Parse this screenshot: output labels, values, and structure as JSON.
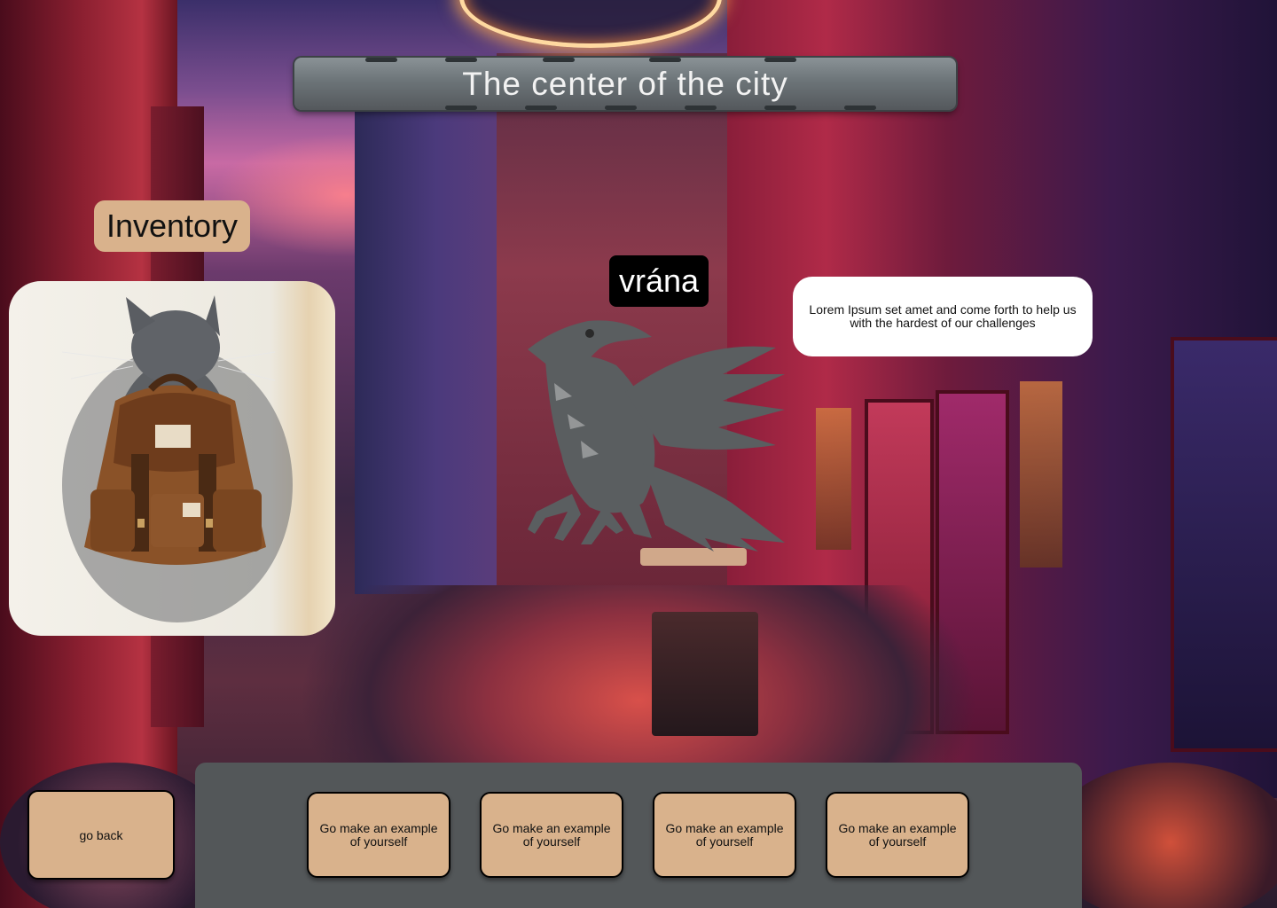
{
  "location": {
    "title": "The center of the city"
  },
  "inventory": {
    "label": "Inventory",
    "item_icon": "cat-with-backpack"
  },
  "npc": {
    "name": "vrána",
    "icon": "raven-icon",
    "dialogue": "Lorem Ipsum set amet and come forth to help us with the hardest of our challenges"
  },
  "navigation": {
    "back_label": "go back"
  },
  "choices": [
    {
      "label": "Go make an example of yourself"
    },
    {
      "label": "Go make an example of yourself"
    },
    {
      "label": "Go make an example of yourself"
    },
    {
      "label": "Go make an example of yourself"
    }
  ],
  "colors": {
    "button_fill": "#d9b28c",
    "panel": "#535759",
    "banner": "#6c7478",
    "raven": "#5a5e60"
  }
}
